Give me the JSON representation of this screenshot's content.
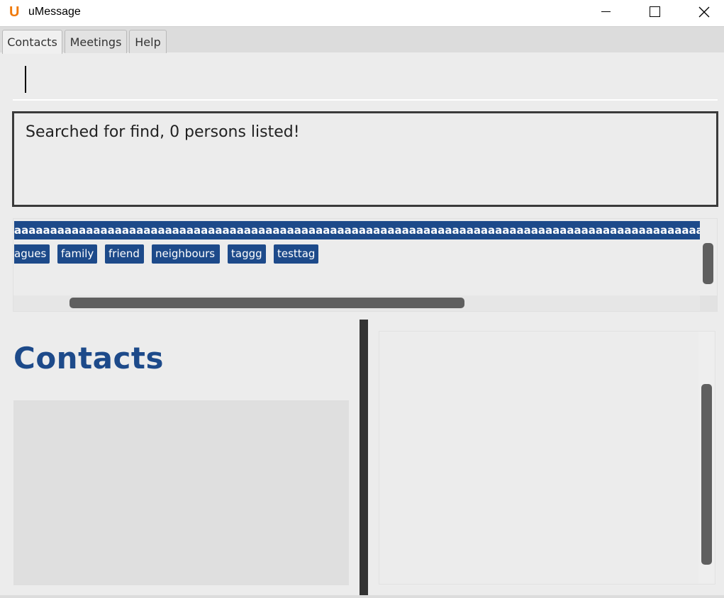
{
  "window": {
    "logo": "U",
    "title": "uMessage",
    "minimize_label": "",
    "maximize_label": "",
    "close_label": "✕"
  },
  "tabs": [
    {
      "label": "Contacts",
      "active": true
    },
    {
      "label": "Meetings",
      "active": false
    },
    {
      "label": "Help",
      "active": false
    }
  ],
  "command_box": {
    "value": ""
  },
  "result": {
    "text": "Searched for find, 0 persons listed!"
  },
  "tags": {
    "long_tag": "aaaaaaaaaaaaaaaaaaaaaaaaaaaaaaaaaaaaaaaaaaaaaaaaaaaaaaaaaaaaaaaaaaaaaaaaaaaaaaaaaaaaaaaaaaaaaaaaaaaaaaaaaaaa",
    "items": [
      "agues",
      "family",
      "friend",
      "neighbours",
      "taggg",
      "testtag"
    ]
  },
  "contacts": {
    "heading": "Contacts"
  },
  "colors": {
    "accent": "#1d4a8a",
    "logo": "#f07a0c",
    "background": "#ececec"
  }
}
